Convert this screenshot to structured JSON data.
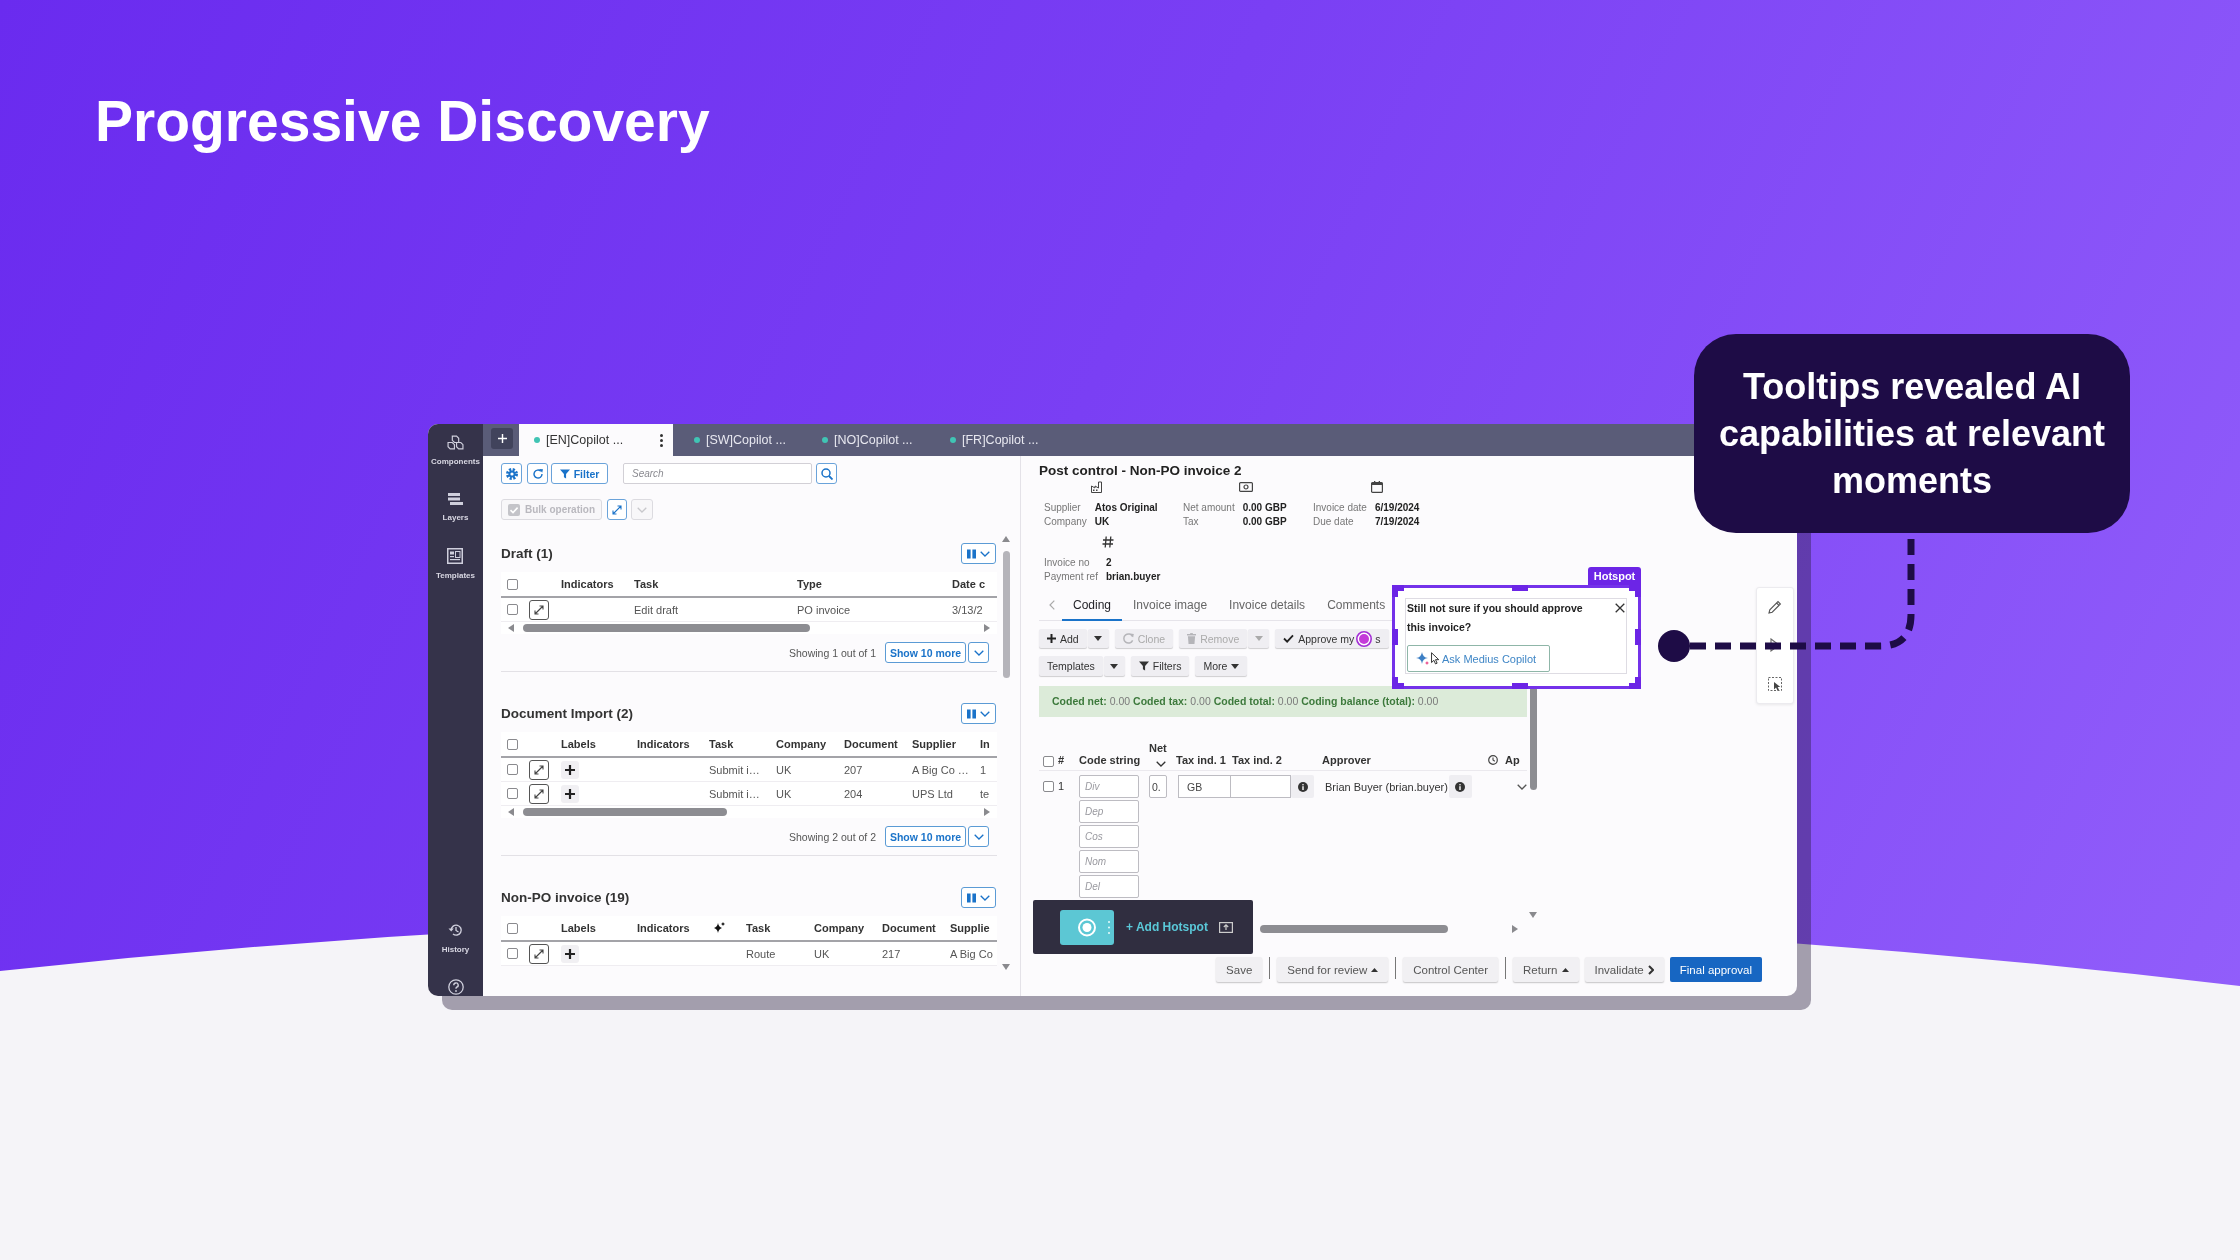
{
  "title": "Progressive Discovery",
  "callout": {
    "text": "Tooltips revealed AI capabilities at relevant moments"
  },
  "app": {
    "sidebar": {
      "items": [
        {
          "label": "Components"
        },
        {
          "label": "Layers"
        },
        {
          "label": "Templates"
        }
      ],
      "footer_items": [
        {
          "label": "History"
        }
      ]
    },
    "tabs": [
      {
        "label": "[EN]Copilot ...",
        "selected": true
      },
      {
        "label": "[SW]Copilot ...",
        "selected": false
      },
      {
        "label": "[NO]Copilot ...",
        "selected": false
      },
      {
        "label": "[FR]Copilot ...",
        "selected": false
      }
    ],
    "list_toolbar": {
      "filter_button": "Filter",
      "search": {
        "placeholder": "Search"
      },
      "bulk_operation": {
        "label": "Bulk operation",
        "disabled": true
      },
      "bulk_menu_disabled": true
    },
    "sections": [
      {
        "title": "Draft (1)",
        "select_all": false,
        "columns": [
          {
            "label": "Indicators",
            "kind": "text"
          },
          {
            "label": "Task",
            "kind": "text"
          },
          {
            "label": "Type",
            "kind": "text"
          },
          {
            "label": "Date c",
            "kind": "text"
          }
        ],
        "rows": [
          {
            "selected": false,
            "cells": [
              null,
              "Edit draft",
              "PO invoice",
              "3/13/2"
            ]
          }
        ],
        "footer": "Showing 1 out of 1",
        "more_button": "Show 10 more"
      },
      {
        "title": "Document Import (2)",
        "select_all": false,
        "columns": [
          {
            "label": "Labels",
            "kind": "labels"
          },
          {
            "label": "Indicators",
            "kind": "text"
          },
          {
            "label": "Task",
            "kind": "text"
          },
          {
            "label": "Company",
            "kind": "text"
          },
          {
            "label": "Document",
            "kind": "text"
          },
          {
            "label": "Supplier",
            "kind": "text"
          },
          {
            "label": "In",
            "kind": "text"
          }
        ],
        "rows": [
          {
            "selected": false,
            "cells": [
              null,
              null,
              "Submit i…",
              "UK",
              "207",
              "A Big Co …",
              "1"
            ]
          },
          {
            "selected": false,
            "cells": [
              null,
              null,
              "Submit i…",
              "UK",
              "204",
              "UPS Ltd",
              "te"
            ]
          }
        ],
        "footer": "Showing 2 out of 2",
        "more_button": "Show 10 more"
      },
      {
        "title": "Non-PO invoice (19)",
        "select_all": false,
        "columns": [
          {
            "label": "Labels",
            "kind": "labels"
          },
          {
            "label": "Indicators",
            "kind": "text"
          },
          {
            "kind": "ai"
          },
          {
            "label": "Task",
            "kind": "text"
          },
          {
            "label": "Company",
            "kind": "text"
          },
          {
            "label": "Document",
            "kind": "text"
          },
          {
            "label": "Supplie",
            "kind": "text"
          }
        ],
        "rows": [
          {
            "selected": false,
            "cells": [
              null,
              null,
              null,
              "Route",
              "UK",
              "217",
              "A Big Co"
            ]
          }
        ]
      }
    ],
    "detail": {
      "title": "Post control - Non-PO invoice 2",
      "field_groups": [
        {
          "fields": [
            {
              "label": "Supplier",
              "value": "Atos Original"
            },
            {
              "label": "Company",
              "value": "UK"
            }
          ]
        },
        {
          "fields": [
            {
              "label": "Net amount",
              "value": "0.00 GBP"
            },
            {
              "label": "Tax",
              "value": "0.00 GBP"
            }
          ]
        },
        {
          "fields": [
            {
              "label": "Invoice date",
              "value": "6/19/2024"
            },
            {
              "label": "Due date",
              "value": "7/19/2024"
            }
          ]
        },
        {
          "fields": [
            {
              "label": "Invoice no",
              "value": "2"
            },
            {
              "label": "Payment ref",
              "value": "brian.buyer"
            }
          ]
        }
      ],
      "tabs": [
        {
          "label": "Coding",
          "selected": true
        },
        {
          "label": "Invoice image",
          "selected": false
        },
        {
          "label": "Invoice details",
          "selected": false
        },
        {
          "label": "Comments",
          "selected": false
        }
      ],
      "actions": [
        {
          "label": "Add",
          "kind": "split",
          "disabled": false
        },
        {
          "label": "Clone",
          "kind": "plain",
          "disabled": true
        },
        {
          "label": "Remove",
          "kind": "split",
          "disabled": true
        },
        {
          "label": "Approve my",
          "label_end": "s",
          "kind": "hotspot",
          "disabled": false
        }
      ],
      "actions_2": [
        {
          "label": "Templates",
          "kind": "split",
          "disabled": false
        },
        {
          "label": "Filters",
          "kind": "plain",
          "disabled": false
        },
        {
          "label": "More",
          "kind": "menu",
          "disabled": false
        }
      ],
      "summary": "**Coded net:** 0.00 **Coded tax:** 0.00 **Coded total:** 0.00 **Coding balance (total):** 0.00",
      "coding_table": {
        "select_all": false,
        "columns": {
          "number": "#",
          "code_string": "Code string",
          "net": "Net",
          "tax_1": "Tax ind. 1",
          "tax_2": "Tax ind. 2",
          "approver": "Approver",
          "column_9": "Ap"
        },
        "rows": [
          {
            "selected": false,
            "number": "1",
            "code_placeholders": [
              "Div",
              "Dep",
              "Cos",
              "Nom",
              "Del"
            ],
            "net": "0.",
            "tax_1": "GB",
            "approver": "Brian Buyer (brian.buyer)"
          }
        ]
      },
      "footer_buttons": [
        {
          "label": "Save",
          "kind": "plain"
        },
        {
          "label": "Send for review",
          "kind": "menu"
        },
        {
          "label": "Control Center",
          "kind": "plain"
        },
        {
          "label": "Return",
          "kind": "menu"
        },
        {
          "label": "Invalidate",
          "kind": "next"
        },
        {
          "label": "Final approval",
          "kind": "primary"
        }
      ]
    }
  },
  "hotspot": {
    "tag": "Hotspot",
    "message": "Still not sure if you should approve this invoice?",
    "button": "Ask Medius Copilot"
  },
  "hotspot_toolbar": {
    "button": "+ Add Hotspot"
  }
}
